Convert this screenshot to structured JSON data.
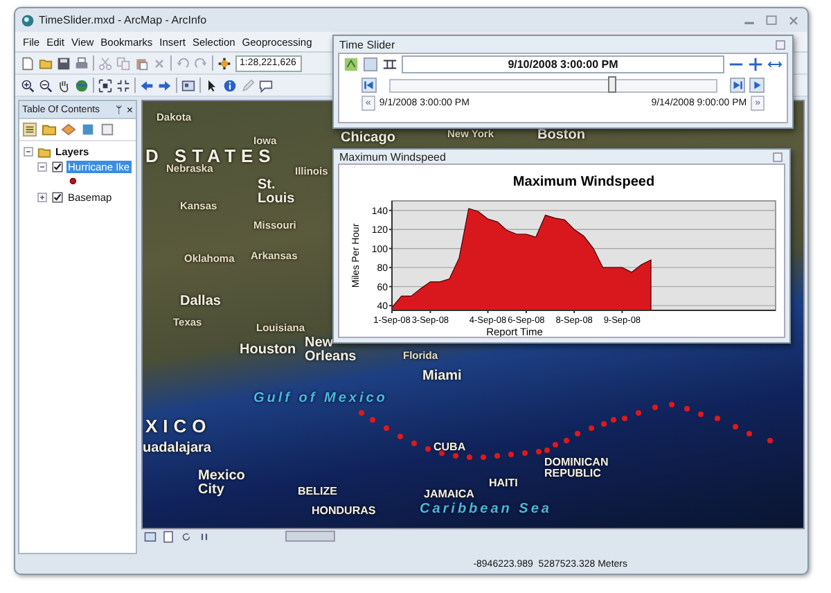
{
  "window": {
    "title": "TimeSlider.mxd - ArcMap - ArcInfo"
  },
  "menu": [
    "File",
    "Edit",
    "View",
    "Bookmarks",
    "Insert",
    "Selection",
    "Geoprocessing"
  ],
  "toolbar": {
    "scale": "1:28,221,626"
  },
  "toc": {
    "title": "Table Of Contents",
    "pin": "ᛘ",
    "close": "×",
    "tree": [
      {
        "label": "Layers",
        "expanded": true,
        "children": [
          {
            "label": "Hurricane Ike",
            "checked": true,
            "selected": true,
            "expanded": true
          },
          {
            "label": "Basemap",
            "checked": true,
            "selected": false,
            "expanded": false
          }
        ]
      }
    ]
  },
  "map": {
    "labels": [
      {
        "text": "Dakota",
        "kind": "region"
      },
      {
        "text": "Iowa",
        "kind": "region"
      },
      {
        "text": "D STATES",
        "kind": "country"
      },
      {
        "text": "Nebraska",
        "kind": "region"
      },
      {
        "text": "Illinois",
        "kind": "region"
      },
      {
        "text": "Chicago",
        "kind": "city"
      },
      {
        "text": "New York",
        "kind": "region"
      },
      {
        "text": "Boston",
        "kind": "city"
      },
      {
        "text": "St. Louis",
        "kind": "city"
      },
      {
        "text": "Kansas",
        "kind": "region"
      },
      {
        "text": "Missouri",
        "kind": "region"
      },
      {
        "text": "Oklahoma",
        "kind": "region"
      },
      {
        "text": "Arkansas",
        "kind": "region"
      },
      {
        "text": "Dallas",
        "kind": "city"
      },
      {
        "text": "Texas",
        "kind": "region"
      },
      {
        "text": "Louisiana",
        "kind": "region"
      },
      {
        "text": "Houston",
        "kind": "city"
      },
      {
        "text": "New Orleans",
        "kind": "city"
      },
      {
        "text": "Florida",
        "kind": "region"
      },
      {
        "text": "Miami",
        "kind": "city"
      },
      {
        "text": "Gulf of Mexico",
        "kind": "water"
      },
      {
        "text": "XICO",
        "kind": "country"
      },
      {
        "text": "uadalajara",
        "kind": "city"
      },
      {
        "text": "Mexico City",
        "kind": "city"
      },
      {
        "text": "BELIZE",
        "kind": "nation"
      },
      {
        "text": "HONDURAS",
        "kind": "nation"
      },
      {
        "text": "CUBA",
        "kind": "nation"
      },
      {
        "text": "DOMINICAN REPUBLIC",
        "kind": "nation"
      },
      {
        "text": "HAITI",
        "kind": "nation"
      },
      {
        "text": "JAMAICA",
        "kind": "nation"
      },
      {
        "text": "Caribbean Sea",
        "kind": "water"
      }
    ]
  },
  "status_bar": {
    "coordinates": "-8946223.989  5287523.328 Meters"
  },
  "time_slider": {
    "title": "Time Slider",
    "current_time": "9/10/2008 3:00:00 PM",
    "level": 0.68,
    "start": "9/1/2008 3:00:00 PM",
    "end": "9/14/2008 9:00:00 PM",
    "back": "«",
    "forward": "»"
  },
  "graph_window": {
    "title": "Maximum Windspeed",
    "chart_data": {
      "type": "area",
      "title": "Maximum Windspeed",
      "xlabel": "Report Time",
      "ylabel": "Miles Per Hour",
      "categories": [
        "1-Sep-08",
        null,
        null,
        null,
        "3-Sep-08",
        null,
        null,
        null,
        null,
        null,
        "4-Sep-08",
        null,
        null,
        null,
        "6-Sep-08",
        null,
        null,
        null,
        null,
        "8-Sep-08",
        null,
        null,
        null,
        null,
        "9-Sep-08",
        null,
        null,
        null,
        null,
        null,
        null,
        null,
        null,
        null,
        null,
        null,
        null,
        null,
        null,
        null,
        null
      ],
      "series": [
        {
          "color": "#d9181e",
          "values": [
            38,
            50,
            50,
            58,
            65,
            65,
            68,
            90,
            142,
            139,
            131,
            128,
            119,
            115,
            115,
            112,
            135,
            132,
            130,
            120,
            113,
            100,
            80,
            80,
            80,
            75,
            83,
            88,
            null,
            null,
            null,
            null,
            null,
            null,
            null,
            null,
            null,
            null,
            null,
            null,
            null
          ]
        }
      ],
      "yticks": [
        40,
        60,
        80,
        100,
        120,
        140
      ],
      "ylim": [
        35,
        150
      ],
      "grid": true
    }
  }
}
